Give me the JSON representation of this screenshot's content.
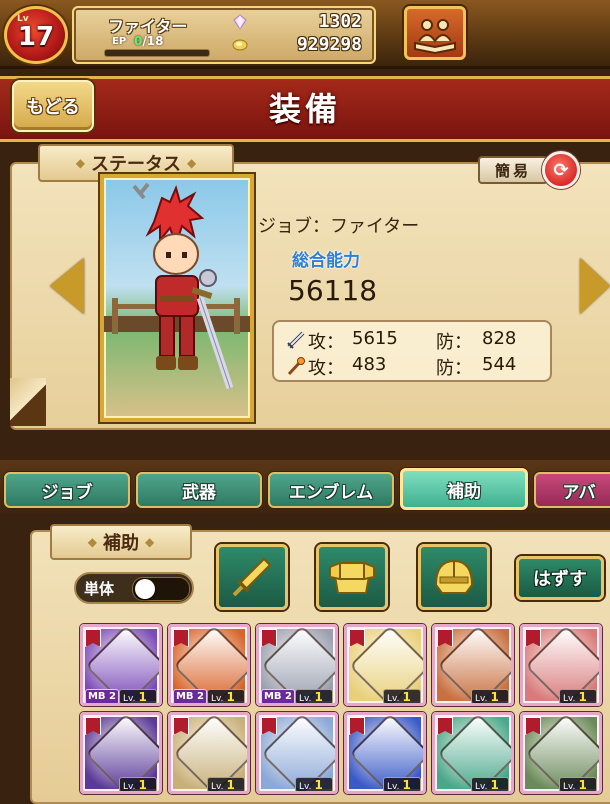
{
  "player": {
    "level_label": "Lv",
    "level": "17",
    "job": "ファイター",
    "ep_label": "EP",
    "ep_current": "0",
    "ep_max": "/18",
    "ep_progress": 0,
    "gems": "1302",
    "coins": "929298"
  },
  "header": {
    "back_label": "もどる",
    "title": "装備"
  },
  "status": {
    "section_title": "ステータス",
    "simple_label": "簡易",
    "job_line": "ジョブ：ファイター",
    "total_label": "総合能力",
    "total_value": "56118",
    "rows": [
      {
        "icon": "sword-icon",
        "atk_label": "攻：",
        "atk": "5615",
        "def_label": "防：",
        "def": "828"
      },
      {
        "icon": "staff-icon",
        "atk_label": "攻：",
        "atk": "483",
        "def_label": "防：",
        "def": "544"
      }
    ]
  },
  "tabs": [
    {
      "label": "ジョブ",
      "active": false
    },
    {
      "label": "武器",
      "active": false
    },
    {
      "label": "エンブレム",
      "active": false
    },
    {
      "label": "補助",
      "active": true
    },
    {
      "label": "アバ",
      "active": false
    }
  ],
  "equip": {
    "section_title": "補助",
    "single_label": "単体",
    "single_on": false,
    "filters": [
      "sword-filter-icon",
      "armor-filter-icon",
      "helmet-filter-icon"
    ],
    "remove_label": "はずす",
    "items": [
      {
        "mb": "MB 2",
        "lv": "1",
        "color": "#7a4ab8"
      },
      {
        "mb": "MB 2",
        "lv": "1",
        "color": "#d8642a"
      },
      {
        "mb": "MB 2",
        "lv": "1",
        "color": "#9aa0b0"
      },
      {
        "mb": "",
        "lv": "1",
        "color": "#e8d07a"
      },
      {
        "mb": "",
        "lv": "1",
        "color": "#c87040"
      },
      {
        "mb": "",
        "lv": "1",
        "color": "#d87a7a"
      },
      {
        "mb": "",
        "lv": "1",
        "color": "#5a3a98"
      },
      {
        "mb": "",
        "lv": "1",
        "color": "#c8b07a"
      },
      {
        "mb": "",
        "lv": "1",
        "color": "#8aa8d8"
      },
      {
        "mb": "",
        "lv": "1",
        "color": "#3a5ac8"
      },
      {
        "mb": "",
        "lv": "1",
        "color": "#4aa88a"
      },
      {
        "mb": "",
        "lv": "1",
        "color": "#6a8a5a"
      }
    ],
    "lv_prefix": "Lv."
  }
}
